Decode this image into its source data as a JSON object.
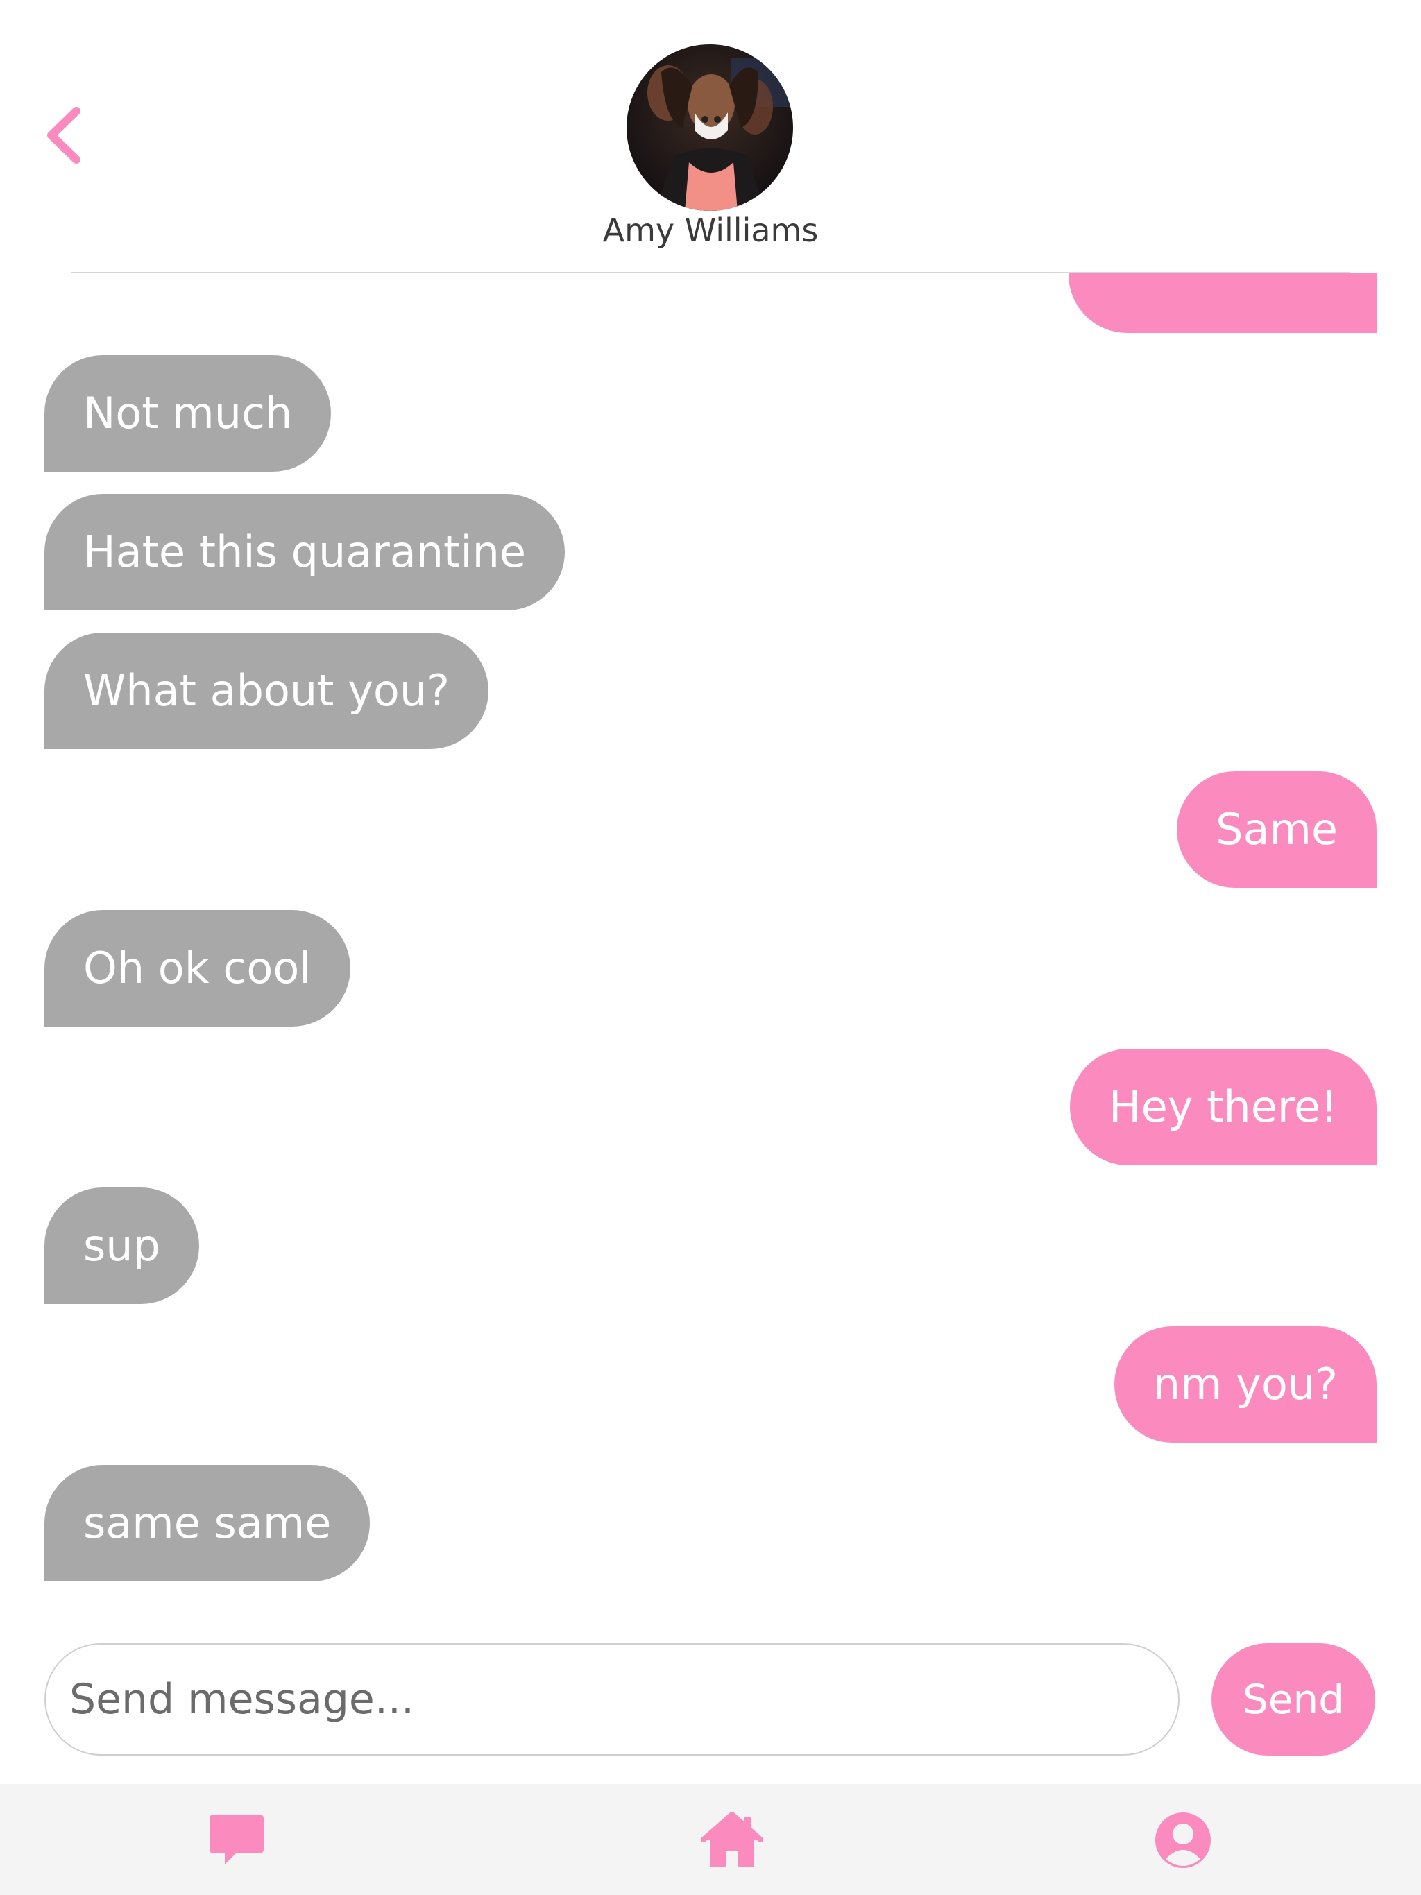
{
  "header": {
    "contact_name": "Amy Williams",
    "back_icon": "chevron-left-icon",
    "avatar": "contact-avatar"
  },
  "messages": [
    {
      "side": "out",
      "text": ""
    },
    {
      "side": "in",
      "text": "Not much"
    },
    {
      "side": "in",
      "text": "Hate this quarantine"
    },
    {
      "side": "in",
      "text": "What about you?"
    },
    {
      "side": "out",
      "text": "Same"
    },
    {
      "side": "in",
      "text": "Oh ok cool"
    },
    {
      "side": "out",
      "text": "Hey there!"
    },
    {
      "side": "in",
      "text": "sup"
    },
    {
      "side": "out",
      "text": "nm you?"
    },
    {
      "side": "in",
      "text": "same same"
    }
  ],
  "composer": {
    "placeholder": "Send message...",
    "value": "",
    "send_label": "Send"
  },
  "tabbar": {
    "items": [
      {
        "icon": "chat-bubble-icon",
        "active": true
      },
      {
        "icon": "home-icon",
        "active": false
      },
      {
        "icon": "user-circle-icon",
        "active": false
      }
    ]
  },
  "colors": {
    "accent": "#fb8bbf",
    "incoming_bubble": "#a8a8a8",
    "tabbar_bg": "#f4f4f4"
  }
}
